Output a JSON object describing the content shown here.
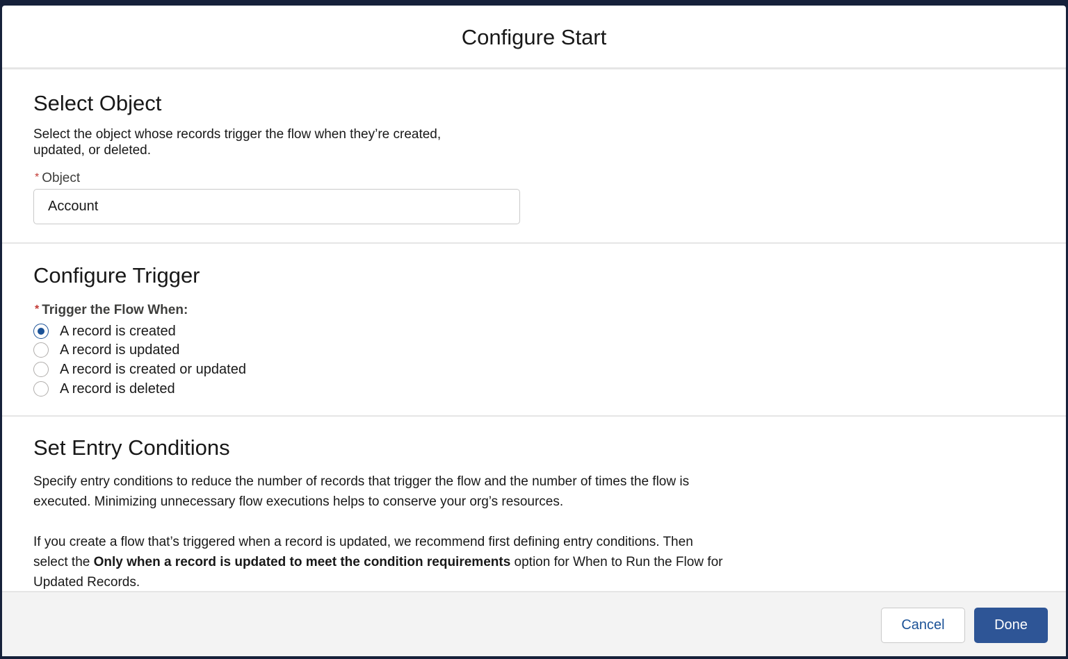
{
  "modal": {
    "title": "Configure Start"
  },
  "select_object": {
    "heading": "Select Object",
    "description_line1": "Select the object whose records trigger the flow when they’re created,",
    "description_line2": "updated, or deleted.",
    "required_marker": "*",
    "object_label": "Object",
    "object_value": "Account"
  },
  "configure_trigger": {
    "heading": "Configure Trigger",
    "required_marker": "*",
    "trigger_label": "Trigger the Flow When:",
    "options": [
      {
        "label": "A record is created",
        "checked": true
      },
      {
        "label": "A record is updated",
        "checked": false
      },
      {
        "label": "A record is created or updated",
        "checked": false
      },
      {
        "label": "A record is deleted",
        "checked": false
      }
    ]
  },
  "entry_conditions": {
    "heading": "Set Entry Conditions",
    "para1_line1": "Specify entry conditions to reduce the number of records that trigger the flow and the number of times the flow is",
    "para1_line2": "executed. Minimizing unnecessary flow executions helps to conserve your org’s resources.",
    "para2_line1": "If you create a flow that’s triggered when a record is updated, we recommend first defining entry conditions. Then",
    "para2_line2_prefix": "select the ",
    "para2_line2_bold": "Only when a record is updated to meet the condition requirements",
    "para2_line2_suffix": " option for When to Run the Flow for",
    "para2_line3": "Updated Records."
  },
  "footer": {
    "cancel_label": "Cancel",
    "done_label": "Done"
  },
  "colors": {
    "primary": "#2e5596",
    "radio_checked": "#1b5297",
    "required": "#c23934",
    "backdrop": "#16213a"
  }
}
